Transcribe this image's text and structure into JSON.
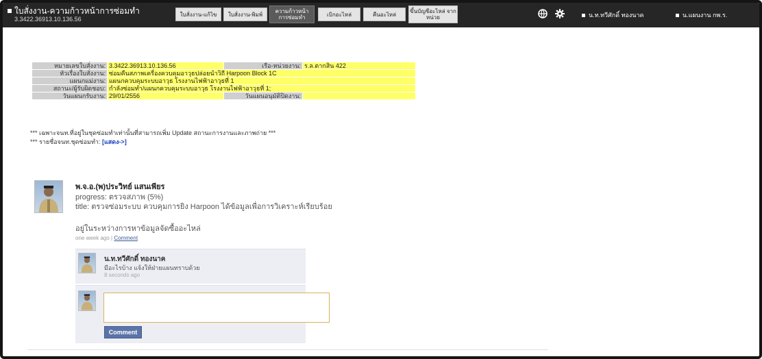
{
  "header": {
    "title": "ใบสั่งงาน-ความก้าวหน้าการซ่อมทำ",
    "subtitle": "3.3422.36913.10.136.56",
    "nav": [
      {
        "label": "ใบสั่งงาน-แก้ไข",
        "active": false
      },
      {
        "label": "ใบสั่งงาน-พิมพ์",
        "active": false
      },
      {
        "label": "ความก้าวหน้า การซ่อมทำ",
        "active": true
      },
      {
        "label": "เบิกอะไหล่",
        "active": false
      },
      {
        "label": "คืนอะไหล่",
        "active": false
      },
      {
        "label": "ขึ้นบัญชีอะไหล่ จากหน่วย",
        "active": false
      }
    ],
    "icons": [
      "globe-icon",
      "gear-icon"
    ],
    "user_name": "น.ท.ทวีศักดิ์ ทองนาค",
    "department": "น.แผนงาน กพ.ร."
  },
  "order": {
    "rows": [
      {
        "l1": "หมายเลขใบสั่งงาน:",
        "v1": "3.3422.36913.10.136.56",
        "l2": "เรือ-หน่วยงาน:",
        "v2": "ร.ล.ตากสิน 422"
      },
      {
        "l1": "หัวเรื่องใบสั่งงาน:",
        "v1": "ซ่อมคืนสภาพเครื่องควบคุมอาวุธปล่อยนำวิถี Harpoon Block 1C"
      },
      {
        "l1": "แผนกแม่งาน:",
        "v1": "แผนกควบคุมระบบอาวุธ โรงงานไฟฟ้าอาวุธที่ 1"
      },
      {
        "l1": "สถานะ/ผู้รับผิดชอบ:",
        "v1": "กำลังซ่อมทำ/แผนกควบคุมระบบอาวุธ โรงงานไฟฟ้าอาวุธที่ 1;"
      },
      {
        "l1": "วันแผนกรับงาน:",
        "v1": "29/01/2556",
        "l2": "วันแผนอนุมัติปิดงาน:",
        "v2": ""
      }
    ],
    "note1": "*** เฉพาะจนท.ที่อยู่ในชุดซ่อมทำเท่านั้นที่สามารถเพิ่ม Update สถานะการงานและภาพถ่าย ***",
    "note2_prefix": "*** รายชื่อจนท.ชุดซ่อมทำ:",
    "note2_link": "[แสดง->]"
  },
  "post": {
    "author": "พ.จ.อ.(พ)ประวิทย์ แสนเพียร",
    "progress": "progress: ตรวจสภาพ (5%)",
    "title": "title: ตรวจซ่อมระบบ ควบคุมการยิง Harpoon ได้ข้อมูลเพื่อการวิเคราะห์เรียบร้อย",
    "status": "อยู่ในระหว่างการหาข้อมูลจัดซื้ออะไหล่",
    "time": "one week ago",
    "sep": " | ",
    "comment_link": "Comment"
  },
  "comments": [
    {
      "author": "น.ท.ทวีศักดิ์ ทองนาค",
      "text": "มีอะไรบ้าง แจ้งให้ฝ่ายแผนทราบด้วย",
      "time": "8 seconds ago"
    }
  ],
  "composer": {
    "value": "",
    "button": "Comment"
  }
}
